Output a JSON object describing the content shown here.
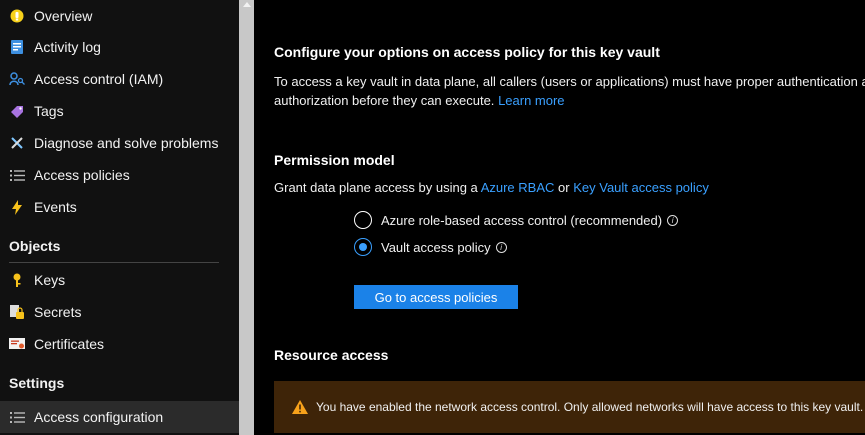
{
  "sidebar": {
    "items": [
      {
        "label": "Overview",
        "icon": "overview-icon"
      },
      {
        "label": "Activity log",
        "icon": "activity-log-icon"
      },
      {
        "label": "Access control (IAM)",
        "icon": "iam-icon"
      },
      {
        "label": "Tags",
        "icon": "tag-icon"
      },
      {
        "label": "Diagnose and solve problems",
        "icon": "wrench-icon"
      },
      {
        "label": "Access policies",
        "icon": "list-icon"
      },
      {
        "label": "Events",
        "icon": "lightning-icon"
      }
    ],
    "objects_header": "Objects",
    "objects_items": [
      {
        "label": "Keys",
        "icon": "key-icon"
      },
      {
        "label": "Secrets",
        "icon": "secret-icon"
      },
      {
        "label": "Certificates",
        "icon": "certificate-icon"
      }
    ],
    "settings_header": "Settings",
    "settings_items": [
      {
        "label": "Access configuration",
        "icon": "list-icon",
        "active": true
      }
    ]
  },
  "main": {
    "title": "Configure your options on access policy for this key vault",
    "description": "To access a key vault in data plane, all callers (users or applications) must have proper authentication and authorization before they can execute.",
    "learn_more": "Learn more",
    "permission_model": {
      "header": "Permission model",
      "grant_text": "Grant data plane access by using a",
      "rbac_link": "Azure RBAC",
      "or_text": "or",
      "kv_policy_link": "Key Vault access policy",
      "options": [
        {
          "label": "Azure role-based access control (recommended)",
          "checked": false
        },
        {
          "label": "Vault access policy",
          "checked": true
        }
      ],
      "button_label": "Go to access policies"
    },
    "resource_access": {
      "header": "Resource access",
      "warning": "You have enabled the network access control. Only allowed networks will have access to this key vault."
    }
  },
  "colors": {
    "accent": "#1b82e8",
    "link": "#3aa0ff",
    "warning_bg": "#3e2408",
    "warning_icon": "#f7a21b"
  }
}
